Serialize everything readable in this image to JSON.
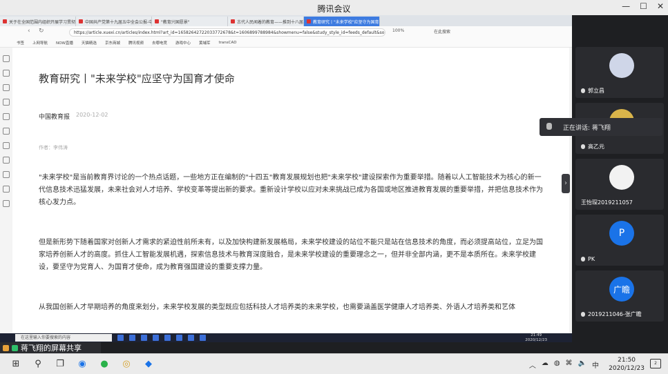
{
  "app": {
    "title": "腾讯会议",
    "window_buttons": [
      "—",
      "☐",
      "✕"
    ]
  },
  "browser": {
    "tabs": [
      {
        "label": "关于在全国范围内组织开展学习贯彻"
      },
      {
        "label": "中国共产党第十九届五中全会公报-中"
      },
      {
        "label": "\"教育兴国愿景\""
      },
      {
        "label": "古代人民闻着的教育——推到十八届"
      },
      {
        "label": "教育研究丨\"未来学校\"应坚守为国育"
      }
    ],
    "address": "https://article.xuexi.cn/articles/index.html?art_id=16582642722033772678&t=1606899788984&showmenu=false&study_style_id=feeds_default&source=share",
    "zoom": "100%",
    "search_placeholder": "在此搜索",
    "bookmarks": [
      "书签",
      "上网导航",
      "NOW直播",
      "天猫精选",
      "京东商城",
      "腾讯视频",
      "去哪电竞",
      "游戏中心",
      "黄埔军",
      "transCAD"
    ]
  },
  "article": {
    "title": "教育研究丨\"未来学校\"应坚守为国育才使命",
    "source": "中国教育报",
    "date": "2020-12-02",
    "author": "作者：李伟涛",
    "paragraphs": [
      "\"未来学校\"是当前教育界讨论的一个热点话题，一些地方正在编制的\"十四五\"教育发展规划也把\"未来学校\"建设探索作为重要举措。随着以人工智能技术为核心的新一代信息技术迅猛发展，未来社会对人才培养、学校变革等提出新的要求。重新设计学校以应对未来挑战已成为各国或地区推进教育发展的重要举措，并把信息技术作为核心发力点。",
      "但是新形势下随着国家对创新人才需求的紧迫性前所未有，以及加快构建新发展格局，未来学校建设的站位不能只是站在信息技术的角度，而必须提高站位，立足为国家培养创新人才的高度。抓住人工智能发展机遇，探索信息技术与教育深度融合，是未来学校建设的重要理念之一，但并非全部内涵，更不是本质所在。未来学校建设，要坚守为党育人、为国育才使命，成为教育强国建设的重要支撑力量。",
      "从我国创新人才早期培养的角度来划分，未来学校发展的类型既应包括科技人才培养类的未来学校，也需要涵盖医学健康人才培养类、外语人才培养类和艺体"
    ]
  },
  "inner_taskbar": {
    "search_placeholder": "在这里输入你要搜索的内容",
    "time": "21:49",
    "date": "2020/12/23"
  },
  "participants": [
    {
      "name": "郭立昌",
      "initial": "",
      "color": "#cfd6e8"
    },
    {
      "name": "高乙元",
      "initial": "",
      "color": "#d9b44a"
    },
    {
      "name": "王怡琛2019211057",
      "initial": "",
      "color": "#f2f2f2"
    },
    {
      "name": "PK",
      "initial": "P",
      "color": "#1a73e8"
    },
    {
      "name": "2019211046-张广瞻",
      "initial": "广瞻",
      "color": "#1a73e8"
    }
  ],
  "speaking": "正在讲话: 蒋飞翔",
  "share_banner": "蒋飞翔的屏幕共享",
  "taskbar": {
    "time": "21:50",
    "date": "2020/12/23",
    "ime": "中",
    "notifications": "2"
  }
}
